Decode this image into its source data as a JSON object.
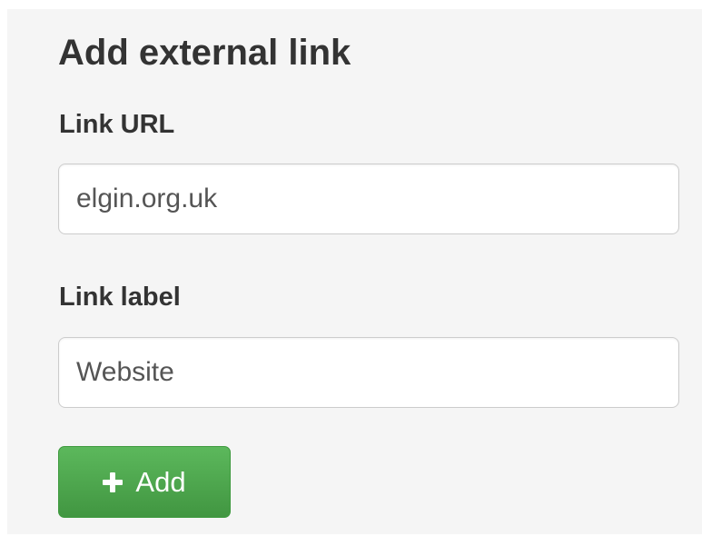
{
  "form": {
    "title": "Add external link",
    "url_label": "Link URL",
    "url_value": "elgin.org.uk",
    "label_label": "Link label",
    "label_value": "Website",
    "add_button_label": "Add",
    "add_button_icon": "plus-icon",
    "add_button_color": "#5cb85c"
  }
}
